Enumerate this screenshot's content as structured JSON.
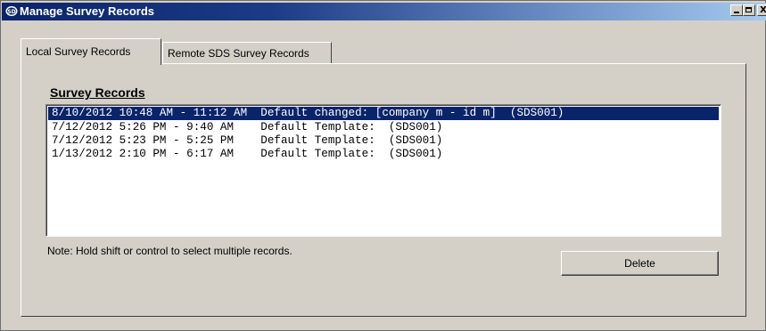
{
  "window": {
    "title": "Manage Survey Records",
    "icon": "app-logo-icon",
    "controls": {
      "minimize": "minimize-icon",
      "maximize": "maximize-icon",
      "close": "close-icon",
      "close_glyph": "X"
    }
  },
  "tabs": [
    {
      "label": "Local Survey Records",
      "active": true
    },
    {
      "label": "Remote SDS Survey Records",
      "active": false
    }
  ],
  "group_label": "Survey Records",
  "records": [
    {
      "text": "8/10/2012 10:48 AM - 11:12 AM  Default changed: [company m - id m]  (SDS001)",
      "selected": true
    },
    {
      "text": "7/12/2012 5:26 PM - 9:40 AM    Default Template:  (SDS001)",
      "selected": false
    },
    {
      "text": "7/12/2012 5:23 PM - 5:25 PM    Default Template:  (SDS001)",
      "selected": false
    },
    {
      "text": "1/13/2012 2:10 PM - 6:17 AM    Default Template:  (SDS001)",
      "selected": false
    }
  ],
  "note": "Note: Hold shift or control to select multiple records.",
  "delete_label": "Delete",
  "colors": {
    "titlebar_start": "#0a246a",
    "titlebar_end": "#a6caf0",
    "selection": "#0a246a",
    "face": "#d4d0c8"
  }
}
